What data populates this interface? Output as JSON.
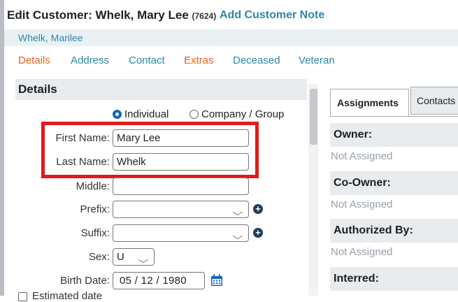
{
  "header": {
    "title": "Edit Customer: Whelk, Mary Lee",
    "customer_id": "(7624)",
    "add_note_link": "Add Customer Note"
  },
  "subtitle": {
    "name_link": "Whelk, Marilee"
  },
  "tabs": [
    {
      "label": "Details",
      "color": "#e2631f"
    },
    {
      "label": "Address",
      "color": "#2f86a8"
    },
    {
      "label": "Contact",
      "color": "#2f86a8"
    },
    {
      "label": "Extras",
      "color": "#e2631f"
    },
    {
      "label": "Deceased",
      "color": "#2f86a8"
    },
    {
      "label": "Veteran",
      "color": "#2f86a8"
    }
  ],
  "details": {
    "section_title": "Details",
    "type_options": [
      {
        "label": "Individual",
        "selected": true
      },
      {
        "label": "Company / Group",
        "selected": false
      }
    ],
    "first_name": {
      "label": "First Name:",
      "value": "Mary Lee"
    },
    "last_name": {
      "label": "Last Name:",
      "value": "Whelk"
    },
    "middle": {
      "label": "Middle:",
      "value": ""
    },
    "prefix": {
      "label": "Prefix:",
      "value": ""
    },
    "suffix": {
      "label": "Suffix:",
      "value": ""
    },
    "sex": {
      "label": "Sex:",
      "value": "U"
    },
    "birth_date": {
      "label": "Birth Date:",
      "value": "05 / 12 / 1980"
    },
    "estimated_date_label": "Estimated date"
  },
  "right_panel": {
    "tabs": [
      "Assignments",
      "Contacts"
    ],
    "active_tab": "Assignments",
    "sections": [
      {
        "title": "Owner:",
        "value": "Not Assigned"
      },
      {
        "title": "Co-Owner:",
        "value": "Not Assigned"
      },
      {
        "title": "Authorized By:",
        "value": "Not Assigned"
      },
      {
        "title": "Interred:",
        "value": ""
      }
    ]
  },
  "colors": {
    "accent_blue": "#2f86a8",
    "accent_orange": "#e2631f",
    "highlight_red": "#e21a1a",
    "radio_blue": "#1565c0",
    "header_gray": "#e8ecef"
  },
  "icons": {
    "chevron": "chevron-down-icon",
    "plus": "plus-circle-icon",
    "calendar": "calendar-icon"
  }
}
